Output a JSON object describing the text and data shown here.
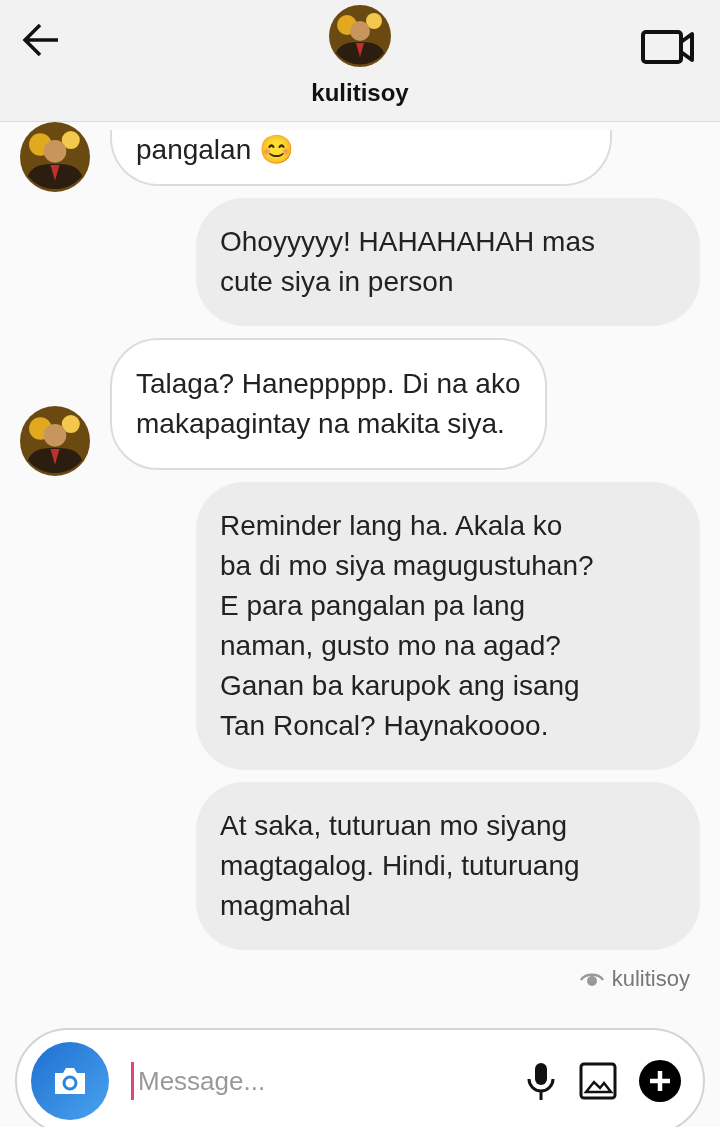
{
  "header": {
    "username": "kulitisoy"
  },
  "messages": [
    {
      "kind": "received",
      "lines": [
        "pangalan 😊"
      ]
    },
    {
      "kind": "sent",
      "lines": [
        "Ohoyyyyy! HAHAHAHAH mas",
        "cute siya in person"
      ]
    },
    {
      "kind": "received",
      "lines": [
        "Talaga? Haneppppp. Di na ako",
        "makapagintay na makita siya."
      ]
    },
    {
      "kind": "sent",
      "lines": [
        "Reminder lang ha. Akala ko",
        "ba di mo siya magugustuhan?",
        "E para pangalan pa lang",
        "naman, gusto mo na agad?",
        "Ganan ba karupok ang isang",
        "Tan Roncal? Haynakoooo."
      ]
    },
    {
      "kind": "sent",
      "lines": [
        "At saka, tuturuan mo siyang",
        "magtagalog. Hindi, tuturuang",
        "magmahal"
      ]
    }
  ],
  "seen": {
    "name": "kulitisoy"
  },
  "composer": {
    "placeholder": "Message..."
  }
}
